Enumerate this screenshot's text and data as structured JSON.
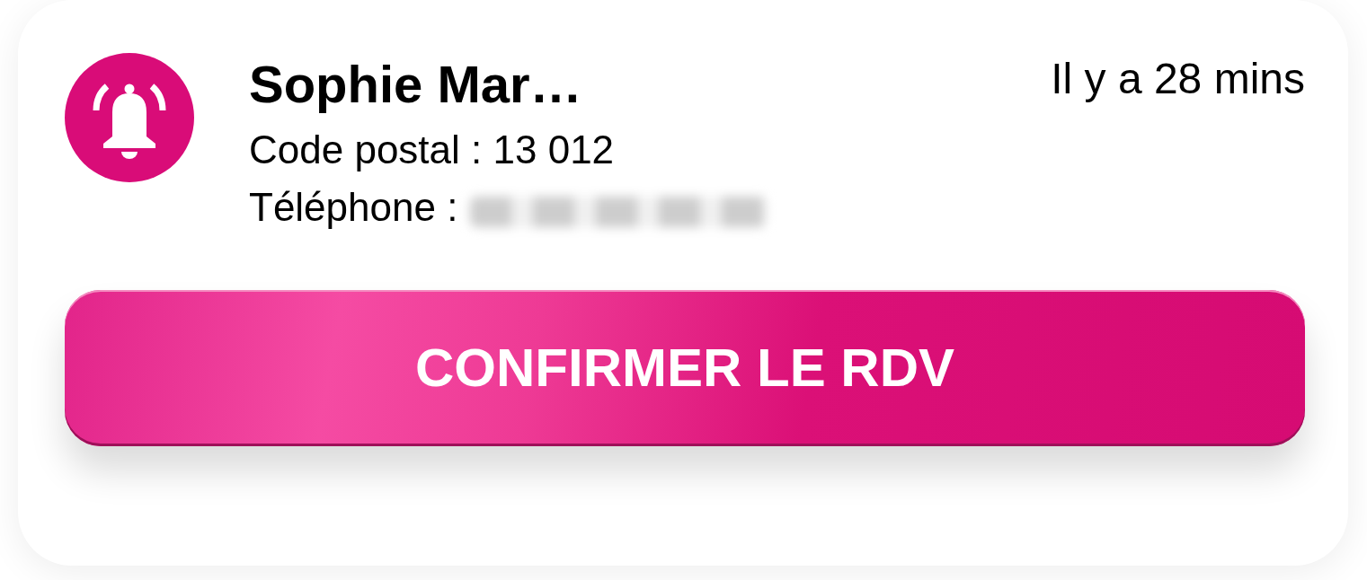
{
  "notification": {
    "title": "Sophie Mar…",
    "postal_code": "Code postal : 13 012",
    "phone": {
      "label": "Téléphone :",
      "blurred": true
    },
    "time": "Il y a 28 mins"
  },
  "action": {
    "label": "CONFIRMER LE RDV"
  }
}
